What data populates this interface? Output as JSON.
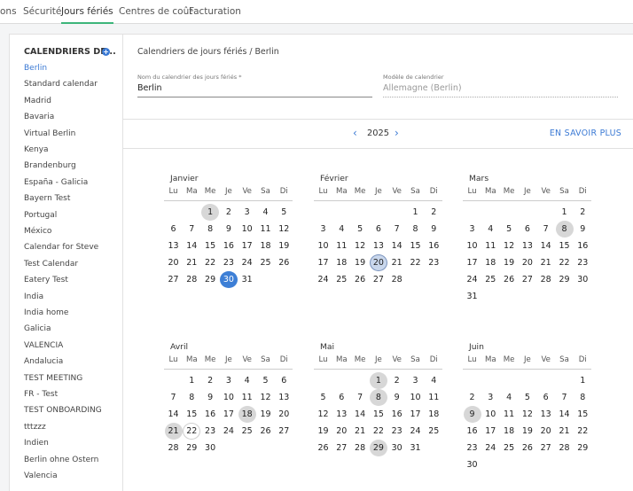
{
  "topnav": {
    "tabs": [
      "ons",
      "Sécurité",
      "Jours fériés",
      "Centres de coût",
      "Facturation"
    ],
    "active": 2
  },
  "sidebar": {
    "title": "CALENDRIERS DE...",
    "items": [
      "Berlin",
      "Standard calendar",
      "Madrid",
      "Bavaria",
      "Virtual Berlin",
      "Kenya",
      "Brandenburg",
      "España - Galicia",
      "Bayern Test",
      "Portugal",
      "México",
      "Calendar for Steve",
      "Test Calendar",
      "Eatery Test",
      "India",
      "India home",
      "Galicia",
      "VALENCIA",
      "Andalucia",
      "TEST MEETING",
      "FR - Test",
      "TEST ONBOARDING",
      "tttzzz",
      "Indien",
      "Berlin ohne Ostern",
      "Valencia"
    ],
    "active": 0
  },
  "main": {
    "breadcrumb": "Calendriers de jours fériés / Berlin",
    "name_label": "Nom du calendrier des jours fériés *",
    "name_value": "Berlin",
    "model_label": "Modèle de calendrier",
    "model_value": "Allemagne (Berlin)",
    "year": "2025",
    "learn_more": "EN SAVOIR PLUS"
  },
  "calendar": {
    "weekdays": [
      "Lu",
      "Ma",
      "Me",
      "Je",
      "Ve",
      "Sa",
      "Di"
    ],
    "months": [
      {
        "name": "Janvier",
        "start": 2,
        "days": 31,
        "holidays": [
          1
        ],
        "selected": [
          30
        ],
        "ringed": [],
        "outlined": []
      },
      {
        "name": "Février",
        "start": 5,
        "days": 28,
        "holidays": [],
        "selected": [],
        "ringed": [
          20
        ],
        "outlined": []
      },
      {
        "name": "Mars",
        "start": 5,
        "days": 31,
        "holidays": [
          8
        ],
        "selected": [],
        "ringed": [],
        "outlined": []
      },
      {
        "name": "Avril",
        "start": 1,
        "days": 30,
        "holidays": [
          18,
          21
        ],
        "selected": [],
        "ringed": [],
        "outlined": [
          22
        ]
      },
      {
        "name": "Mai",
        "start": 3,
        "days": 31,
        "holidays": [
          1,
          8,
          29
        ],
        "selected": [],
        "ringed": [],
        "outlined": []
      },
      {
        "name": "Juin",
        "start": 6,
        "days": 30,
        "holidays": [
          9
        ],
        "selected": [],
        "ringed": [],
        "outlined": []
      }
    ]
  }
}
